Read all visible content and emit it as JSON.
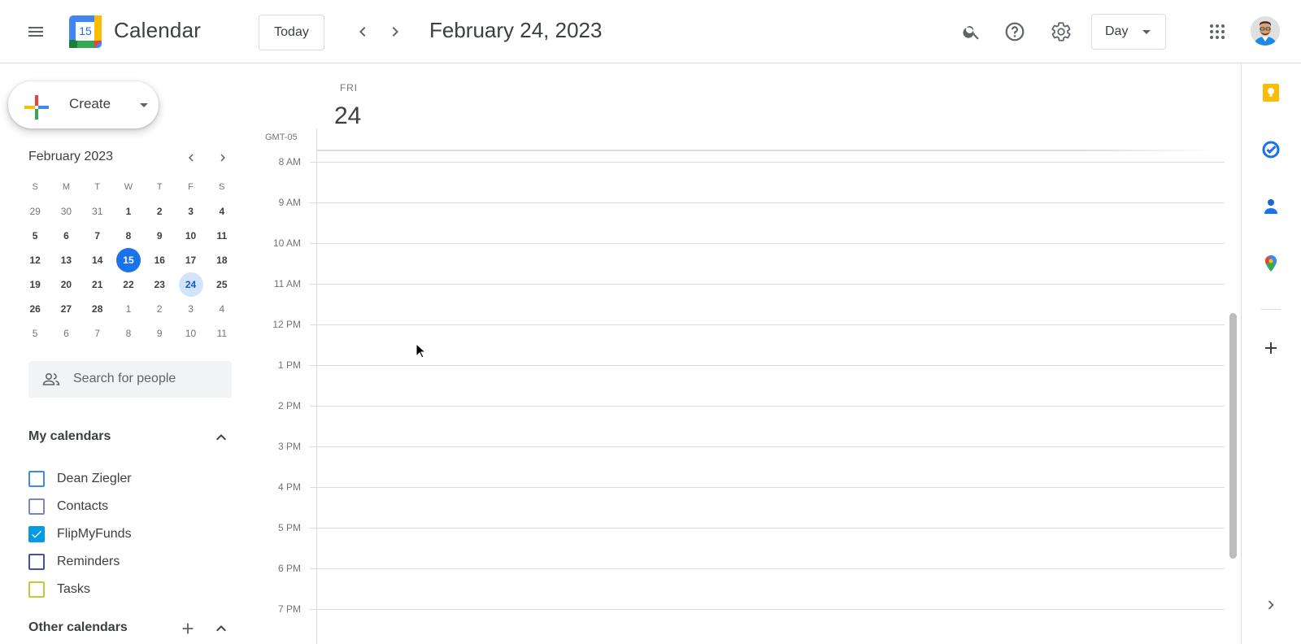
{
  "header": {
    "app_title": "Calendar",
    "logo_day": "15",
    "today_label": "Today",
    "date_title": "February 24, 2023",
    "view_label": "Day"
  },
  "sidebar": {
    "create_label": "Create",
    "mini_month": "February 2023",
    "weekday_headers": [
      "S",
      "M",
      "T",
      "W",
      "T",
      "F",
      "S"
    ],
    "weeks": [
      [
        "29",
        "30",
        "31",
        "1",
        "2",
        "3",
        "4"
      ],
      [
        "5",
        "6",
        "7",
        "8",
        "9",
        "10",
        "11"
      ],
      [
        "12",
        "13",
        "14",
        "15",
        "16",
        "17",
        "18"
      ],
      [
        "19",
        "20",
        "21",
        "22",
        "23",
        "24",
        "25"
      ],
      [
        "26",
        "27",
        "28",
        "1",
        "2",
        "3",
        "4"
      ],
      [
        "5",
        "6",
        "7",
        "8",
        "9",
        "10",
        "11"
      ]
    ],
    "today_day": "15",
    "selected_day": "24",
    "people_search_placeholder": "Search for people",
    "my_calendars_title": "My calendars",
    "my_calendars": [
      {
        "label": "Dean Ziegler",
        "color": "#4285f4",
        "checked": false
      },
      {
        "label": "Contacts",
        "color": "#7986cb",
        "checked": false
      },
      {
        "label": "FlipMyFunds",
        "color": "#039be5",
        "checked": true
      },
      {
        "label": "Reminders",
        "color": "#3f51b5",
        "checked": false
      },
      {
        "label": "Tasks",
        "color": "#c0ca33",
        "checked": false
      }
    ],
    "other_calendars_title": "Other calendars"
  },
  "main": {
    "day_abbrev": "FRI",
    "day_number": "24",
    "timezone": "GMT-05",
    "hours": [
      "8 AM",
      "9 AM",
      "10 AM",
      "11 AM",
      "12 PM",
      "1 PM",
      "2 PM",
      "3 PM",
      "4 PM",
      "5 PM",
      "6 PM",
      "7 PM"
    ]
  },
  "colors": {
    "accent_blue": "#1a73e8",
    "selected_day_bg": "#d2e3fc",
    "keep_yellow": "#fbbc04"
  },
  "side_panel": {
    "icons": [
      "keep-icon",
      "tasks-icon",
      "contacts-icon",
      "maps-icon",
      "add-icon",
      "expand-chevron-icon"
    ]
  }
}
